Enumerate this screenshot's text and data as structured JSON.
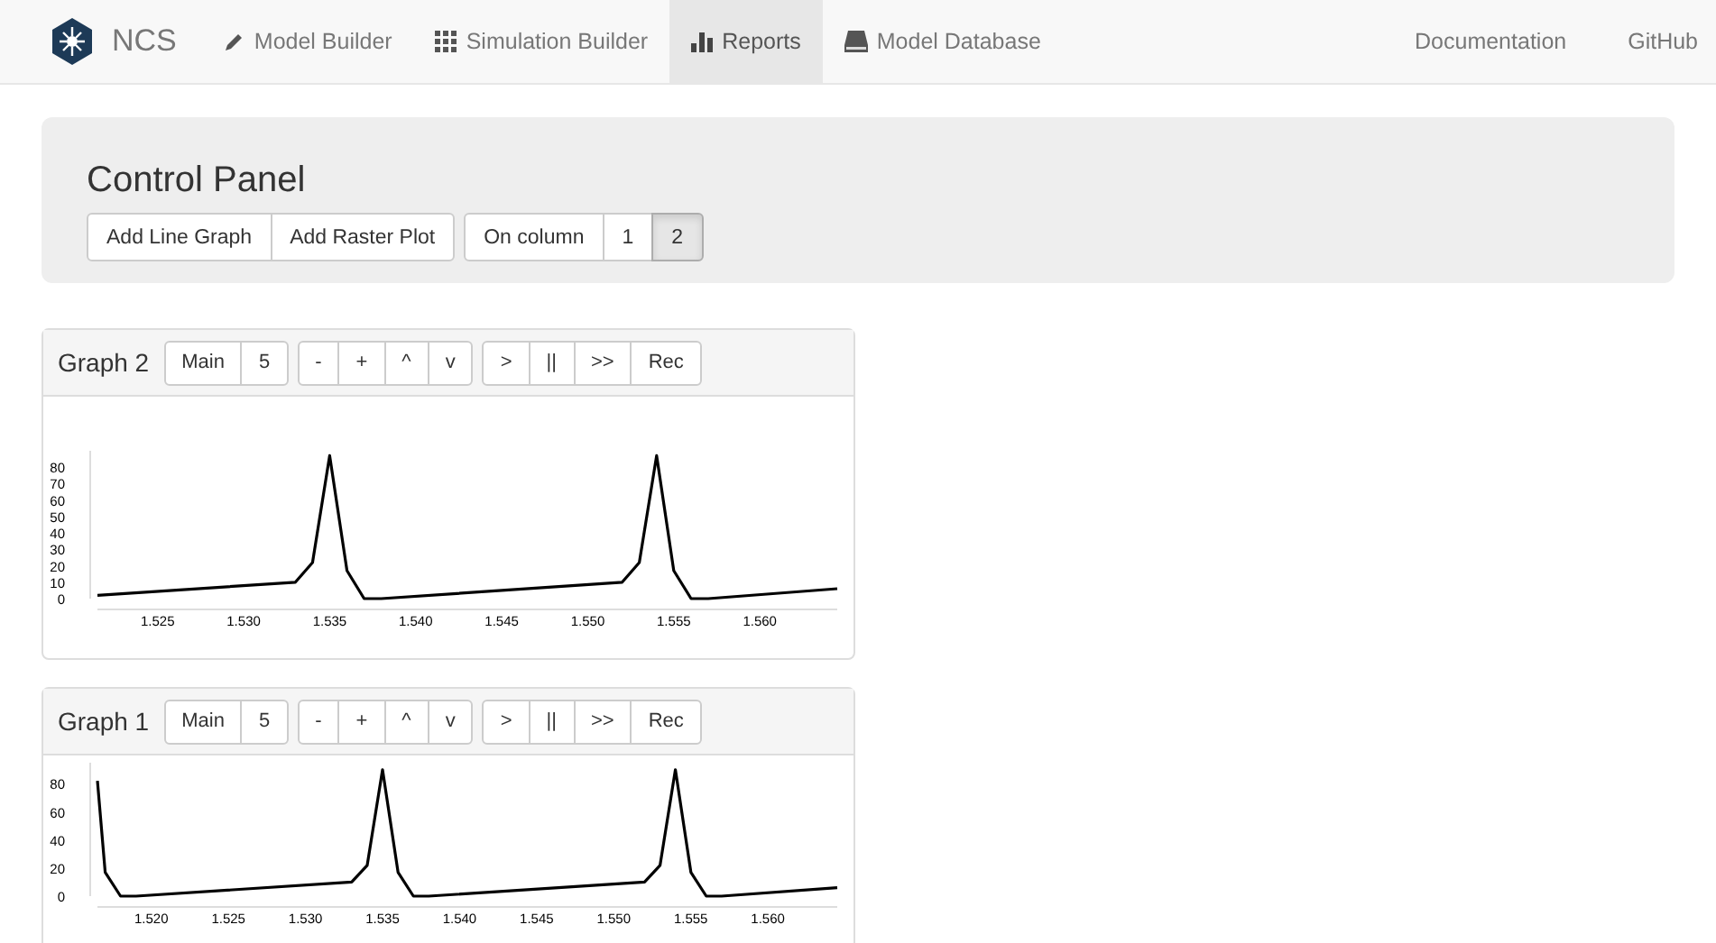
{
  "navbar": {
    "brand": "NCS",
    "items": [
      {
        "label": "Model Builder",
        "selected": false
      },
      {
        "label": "Simulation Builder",
        "selected": false
      },
      {
        "label": "Reports",
        "selected": true
      },
      {
        "label": "Model Database",
        "selected": false
      }
    ],
    "right_links": [
      "Documentation",
      "GitHub"
    ]
  },
  "control_panel": {
    "title": "Control Panel",
    "add_buttons": [
      "Add Line Graph",
      "Add Raster Plot"
    ],
    "column_label": "On column",
    "columns": [
      {
        "label": "1",
        "selected": false
      },
      {
        "label": "2",
        "selected": true
      }
    ]
  },
  "graphs": [
    {
      "title": "Graph 2",
      "source": "Main",
      "count": "5",
      "zoom_buttons": [
        "-",
        "+",
        "^",
        "v"
      ],
      "play_buttons": [
        ">",
        "||",
        ">>",
        "Rec"
      ],
      "chart_data": {
        "type": "line",
        "xlim": [
          1.5215,
          1.5645
        ],
        "ylim": [
          0,
          90
        ],
        "xticks": [
          {
            "value": 1.525,
            "label": "1.525"
          },
          {
            "value": 1.53,
            "label": "1.530"
          },
          {
            "value": 1.535,
            "label": "1.535"
          },
          {
            "value": 1.54,
            "label": "1.540"
          },
          {
            "value": 1.545,
            "label": "1.545"
          },
          {
            "value": 1.55,
            "label": "1.550"
          },
          {
            "value": 1.555,
            "label": "1.555"
          },
          {
            "value": 1.56,
            "label": "1.560"
          }
        ],
        "yticks": [
          0,
          10,
          20,
          30,
          40,
          50,
          60,
          70,
          80
        ],
        "x": [
          1.5215,
          1.533,
          1.534,
          1.535,
          1.536,
          1.537,
          1.538,
          1.552,
          1.553,
          1.554,
          1.555,
          1.556,
          1.557,
          1.5645
        ],
        "series": [
          {
            "color": "#000000",
            "values": [
              2,
              10,
              22,
              87,
              17,
              0,
              0,
              10,
              22,
              87,
              17,
              0,
              0,
              6
            ]
          }
        ]
      }
    },
    {
      "title": "Graph 1",
      "source": "Main",
      "count": "5",
      "zoom_buttons": [
        "-",
        "+",
        "^",
        "v"
      ],
      "play_buttons": [
        ">",
        "||",
        ">>",
        "Rec"
      ],
      "chart_data": {
        "type": "line",
        "xlim": [
          1.5165,
          1.5645
        ],
        "ylim": [
          0,
          95
        ],
        "xticks": [
          {
            "value": 1.52,
            "label": "1.520"
          },
          {
            "value": 1.525,
            "label": "1.525"
          },
          {
            "value": 1.53,
            "label": "1.530"
          },
          {
            "value": 1.535,
            "label": "1.535"
          },
          {
            "value": 1.54,
            "label": "1.540"
          },
          {
            "value": 1.545,
            "label": "1.545"
          },
          {
            "value": 1.55,
            "label": "1.550"
          },
          {
            "value": 1.555,
            "label": "1.555"
          },
          {
            "value": 1.56,
            "label": "1.560"
          }
        ],
        "yticks": [
          0,
          20,
          40,
          60,
          80
        ],
        "x": [
          1.5165,
          1.517,
          1.518,
          1.519,
          1.533,
          1.534,
          1.535,
          1.536,
          1.537,
          1.538,
          1.552,
          1.553,
          1.554,
          1.555,
          1.556,
          1.557,
          1.5645
        ],
        "series": [
          {
            "color": "#000000",
            "values": [
              82,
              17,
              0,
              0,
              10,
              22,
              90,
              17,
              0,
              0,
              10,
              22,
              90,
              17,
              0,
              0,
              6
            ]
          }
        ]
      }
    }
  ]
}
